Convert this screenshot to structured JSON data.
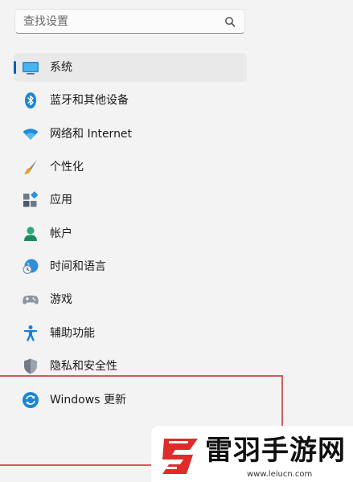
{
  "search": {
    "placeholder": "查找设置",
    "icon": "search-icon"
  },
  "nav": {
    "selected": "system",
    "items": [
      {
        "id": "system",
        "label": "系统",
        "icon": "system-display-icon"
      },
      {
        "id": "bluetooth",
        "label": "蓝牙和其他设备",
        "icon": "bluetooth-icon"
      },
      {
        "id": "network",
        "label": "网络和 Internet",
        "icon": "wifi-icon"
      },
      {
        "id": "personalization",
        "label": "个性化",
        "icon": "brush-icon"
      },
      {
        "id": "apps",
        "label": "应用",
        "icon": "apps-icon"
      },
      {
        "id": "accounts",
        "label": "帐户",
        "icon": "account-icon"
      },
      {
        "id": "time",
        "label": "时间和语言",
        "icon": "globe-clock-icon"
      },
      {
        "id": "gaming",
        "label": "游戏",
        "icon": "gamepad-icon"
      },
      {
        "id": "accessibility",
        "label": "辅助功能",
        "icon": "accessibility-icon"
      },
      {
        "id": "privacy",
        "label": "隐私和安全性",
        "icon": "shield-icon"
      },
      {
        "id": "update",
        "label": "Windows 更新",
        "icon": "windows-update-icon"
      }
    ]
  },
  "watermark": {
    "brand": "雷羽手游网",
    "url": "www.leiucn.com"
  },
  "colors": {
    "accent": "#005fb8",
    "highlight_border": "#d35b5b",
    "selected_bg": "#e9e9e9",
    "background": "#f3f3f3"
  }
}
